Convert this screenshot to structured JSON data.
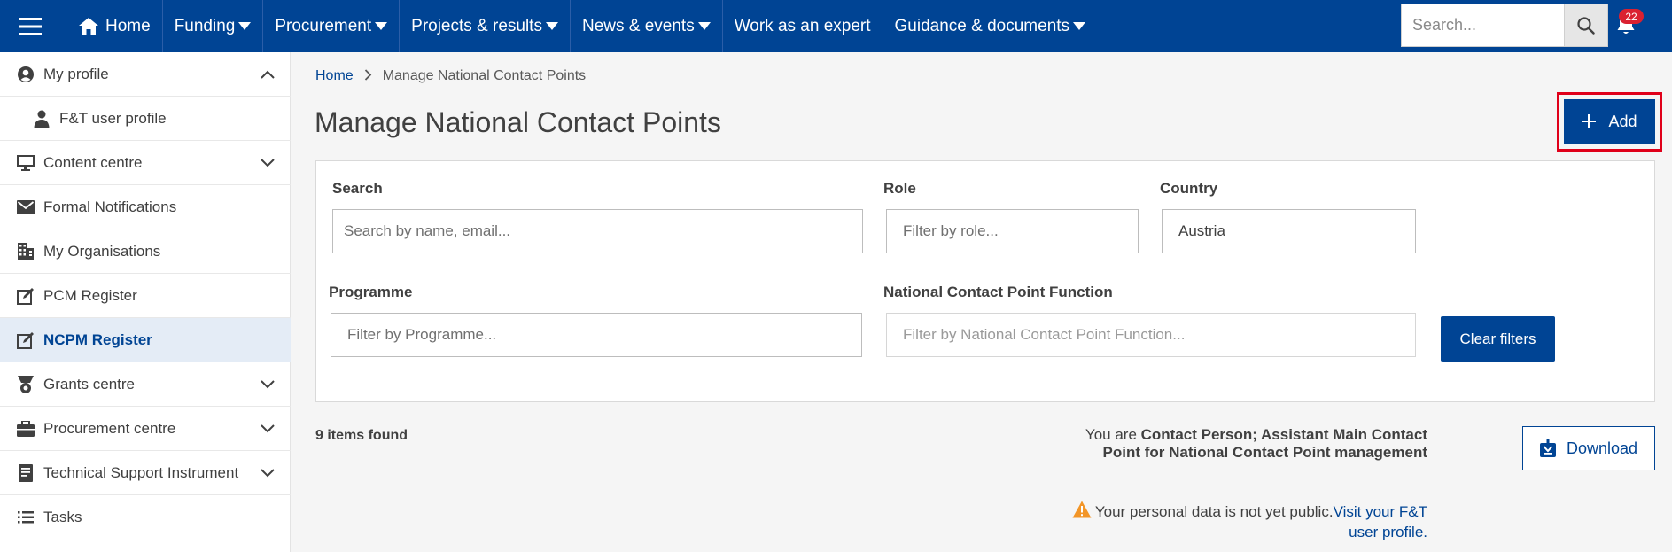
{
  "topnav": {
    "home": "Home",
    "items": [
      {
        "label": "Funding",
        "dropdown": true
      },
      {
        "label": "Procurement",
        "dropdown": true
      },
      {
        "label": "Projects & results",
        "dropdown": true
      },
      {
        "label": "News & events",
        "dropdown": true
      },
      {
        "label": "Work as an expert",
        "dropdown": false
      },
      {
        "label": "Guidance & documents",
        "dropdown": true
      }
    ],
    "search_placeholder": "Search...",
    "notification_count": "22"
  },
  "sidebar": {
    "items": [
      {
        "label": "My profile",
        "icon": "user-circle-icon",
        "expanded": true
      },
      {
        "label": "F&T user profile",
        "icon": "person-icon",
        "sub": true
      },
      {
        "label": "Content centre",
        "icon": "monitor-icon",
        "expandable": true
      },
      {
        "label": "Formal Notifications",
        "icon": "envelope-icon"
      },
      {
        "label": "My Organisations",
        "icon": "building-icon"
      },
      {
        "label": "PCM Register",
        "icon": "edit-icon"
      },
      {
        "label": "NCPM Register",
        "icon": "edit-icon",
        "active": true
      },
      {
        "label": "Grants centre",
        "icon": "grants-icon",
        "expandable": true
      },
      {
        "label": "Procurement centre",
        "icon": "briefcase-icon",
        "expandable": true
      },
      {
        "label": "Technical Support Instrument",
        "icon": "document-icon",
        "expandable": true
      },
      {
        "label": "Tasks",
        "icon": "list-icon"
      }
    ]
  },
  "breadcrumb": {
    "home": "Home",
    "current": "Manage National Contact Points"
  },
  "page": {
    "title": "Manage National Contact Points",
    "add_label": "Add"
  },
  "filters": {
    "search": {
      "label": "Search",
      "placeholder": "Search by name, email...",
      "value": ""
    },
    "role": {
      "label": "Role",
      "placeholder": "Filter by role...",
      "value": ""
    },
    "country": {
      "label": "Country",
      "placeholder": "",
      "value": "Austria"
    },
    "programme": {
      "label": "Programme",
      "placeholder": "Filter by Programme...",
      "value": ""
    },
    "ncp_function": {
      "label": "National Contact Point Function",
      "placeholder": "Filter by National Contact Point Function...",
      "value": ""
    },
    "clear_label": "Clear filters"
  },
  "results": {
    "count_text": "9 items found",
    "role_prefix": "You are ",
    "role_value": "Contact Person; Assistant Main Contact Point for National Contact Point management",
    "notice_text": "Your personal data is not yet public.",
    "notice_link": "Visit your F&T user profile.",
    "download_label": "Download"
  },
  "colors": {
    "brand": "#004494",
    "highlight": "#e0001a",
    "warning": "#f29527",
    "badge": "#da2131"
  }
}
